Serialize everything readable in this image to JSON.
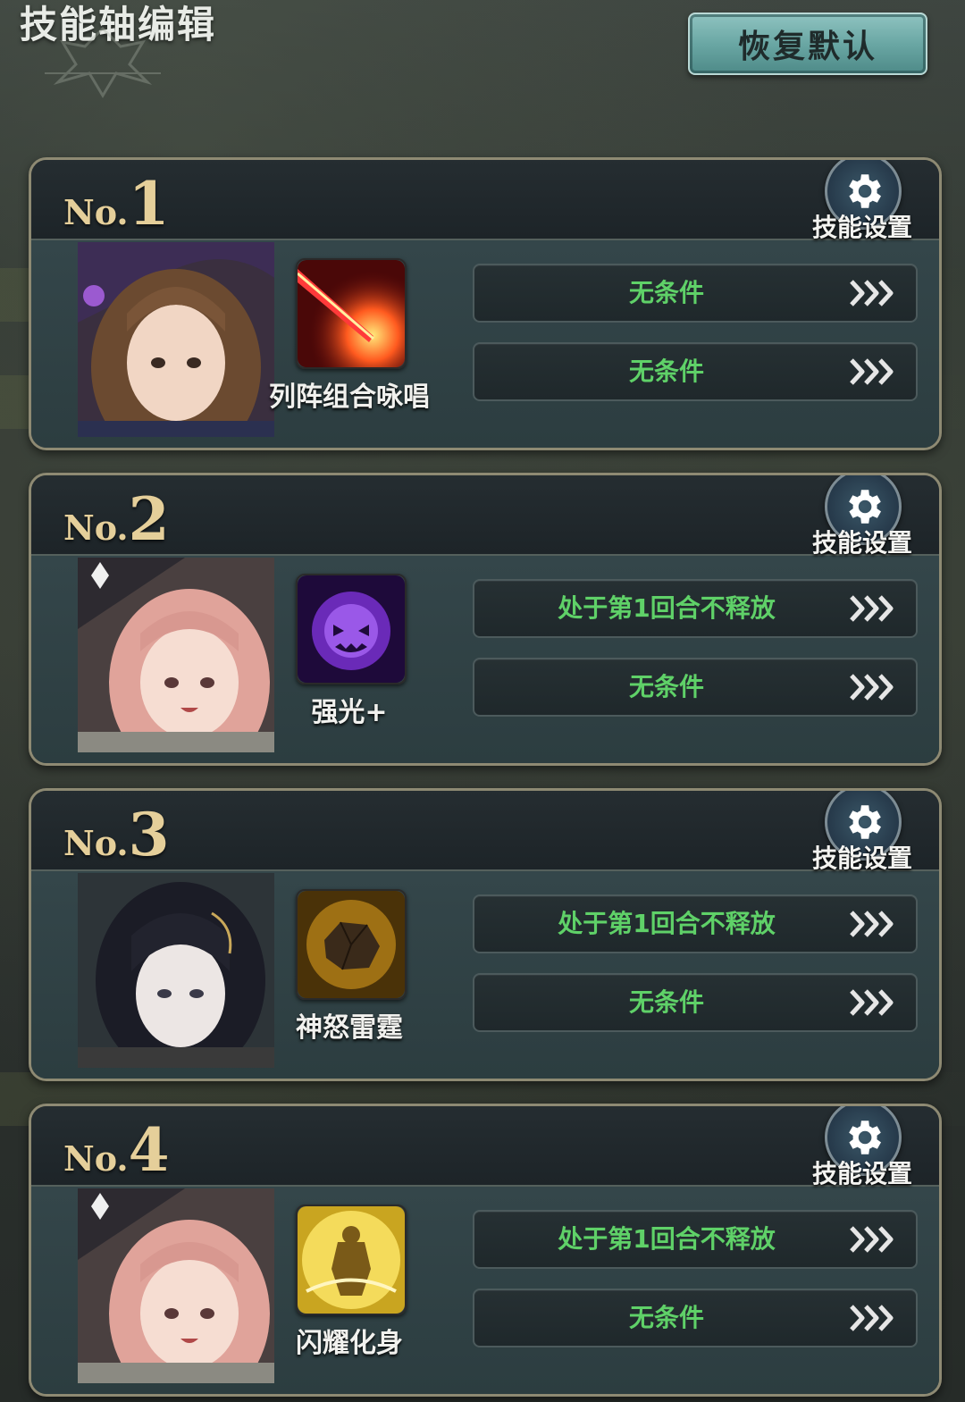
{
  "header": {
    "title": "技能轴编辑",
    "reset_label": "恢复默认"
  },
  "slots": [
    {
      "prefix": "No.",
      "number": "1",
      "settings_label": "技能设置",
      "character": "brown-hair-witch-portrait",
      "skill_icon": "red-beam-skill-icon",
      "skill_name": "列阵组合咏唱",
      "conditions": [
        "无条件",
        "无条件"
      ]
    },
    {
      "prefix": "No.",
      "number": "2",
      "settings_label": "技能设置",
      "character": "pink-hair-witch-portrait",
      "skill_icon": "purple-skull-skill-icon",
      "skill_name": "强光+",
      "conditions": [
        "处于第1回合不释放",
        "无条件"
      ]
    },
    {
      "prefix": "No.",
      "number": "3",
      "settings_label": "技能设置",
      "character": "black-hair-girl-portrait",
      "skill_icon": "golden-rock-skill-icon",
      "skill_name": "神怒雷霆",
      "conditions": [
        "处于第1回合不释放",
        "无条件"
      ]
    },
    {
      "prefix": "No.",
      "number": "4",
      "settings_label": "技能设置",
      "character": "pink-hair-witch-portrait",
      "skill_icon": "golden-warrior-skill-icon",
      "skill_name": "闪耀化身",
      "conditions": [
        "处于第1回合不释放",
        "无条件"
      ]
    }
  ],
  "colors": {
    "condition_text": "#5fd168",
    "slot_number": "#e5cf9a",
    "reset_button": "#6aa7a4"
  }
}
